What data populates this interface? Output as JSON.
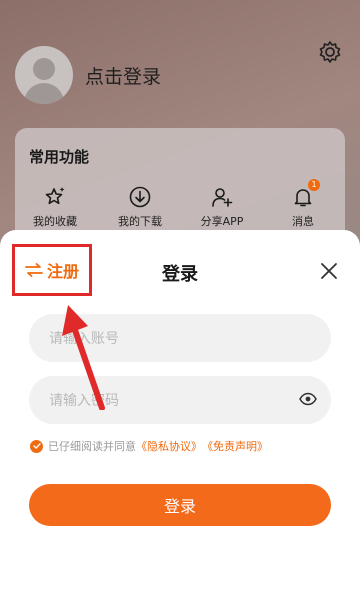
{
  "profile": {
    "login_prompt": "点击登录"
  },
  "functions": {
    "title": "常用功能",
    "items": [
      {
        "label": "我的收藏",
        "icon": "star-sparkle-icon"
      },
      {
        "label": "我的下载",
        "icon": "download-icon"
      },
      {
        "label": "分享APP",
        "icon": "add-user-icon"
      },
      {
        "label": "消息",
        "icon": "bell-icon",
        "badge": "1"
      }
    ]
  },
  "login_sheet": {
    "register_label": "注册",
    "title": "登录",
    "account_placeholder": "请输入账号",
    "password_placeholder": "请输入密码",
    "agree_text": "已仔细阅读并同意",
    "privacy_link": "《隐私协议》",
    "disclaimer_link": "《免责声明》",
    "login_button": "登录"
  },
  "colors": {
    "accent": "#f06a0f",
    "annotation_red": "#e02a2a"
  }
}
